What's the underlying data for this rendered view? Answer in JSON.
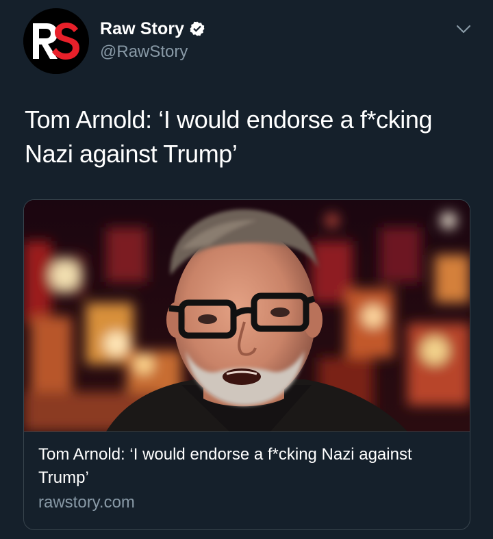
{
  "account": {
    "name": "Raw Story",
    "handle": "@RawStory",
    "verified": true,
    "avatar_icon": "rawstory-logo-icon",
    "avatar_logo_text": "RS"
  },
  "menu": {
    "icon": "chevron-down-icon"
  },
  "tweet": {
    "text": "Tom Arnold: ‘I would endorse a f*cking Nazi against Trump’"
  },
  "link_card": {
    "image_icon": "article-thumbnail-photo",
    "title": "Tom Arnold: ‘I would endorse a f*cking Nazi against Trump’",
    "domain": "rawstory.com"
  },
  "colors": {
    "background": "#15202b",
    "text_primary": "#ffffff",
    "text_secondary": "#8899a6",
    "border": "#38444d",
    "verified_badge": "#ffffff",
    "brand_red": "#e8202a"
  }
}
